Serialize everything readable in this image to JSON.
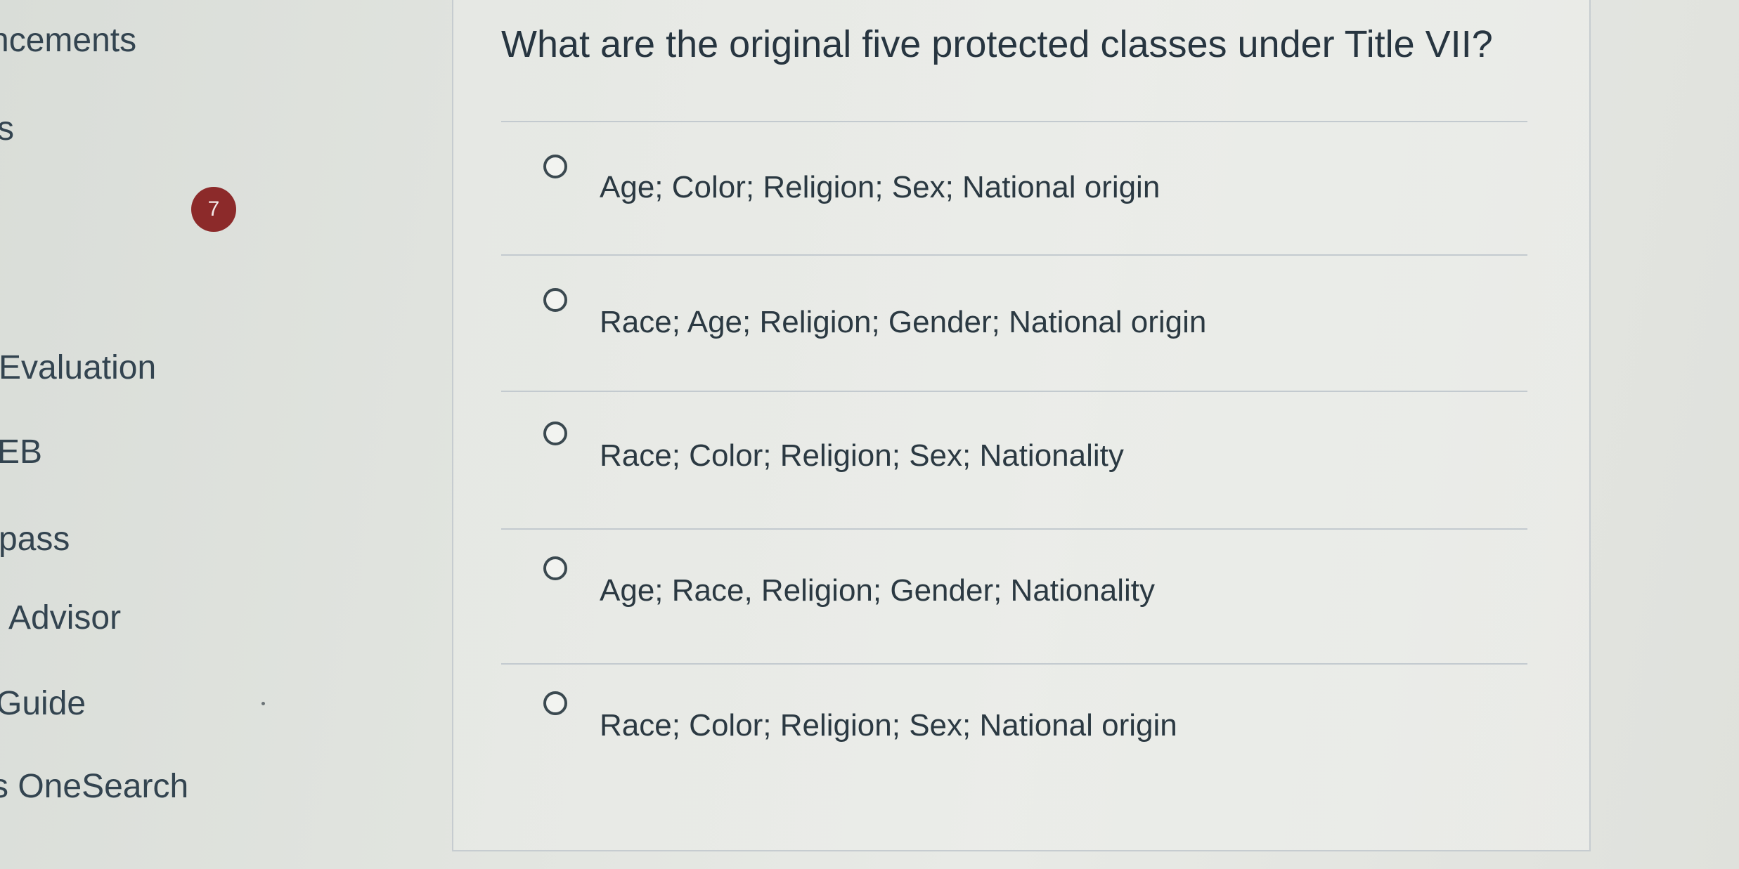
{
  "sidebar": {
    "items": [
      {
        "label": "ncements"
      },
      {
        "label": "s"
      },
      {
        "label": "Evaluation"
      },
      {
        "label": "EB"
      },
      {
        "label": "pass"
      },
      {
        "label": "Advisor"
      },
      {
        "label": "Guide"
      },
      {
        "label": "s OneSearch"
      }
    ],
    "badge_count": "7"
  },
  "question": {
    "text": "What are the original five protected classes under Title VII?",
    "options": [
      {
        "label": "Age; Color; Religion; Sex; National origin",
        "selected": false
      },
      {
        "label": "Race; Age; Religion; Gender; National origin",
        "selected": false
      },
      {
        "label": "Race; Color; Religion; Sex; Nationality",
        "selected": false
      },
      {
        "label": "Age; Race, Religion; Gender; Nationality",
        "selected": false
      },
      {
        "label": "Race; Color; Religion; Sex; National origin",
        "selected": false
      }
    ]
  },
  "colors": {
    "badge": "#8c2a2a",
    "text": "#2d3b45",
    "background": "#e1e4df"
  }
}
